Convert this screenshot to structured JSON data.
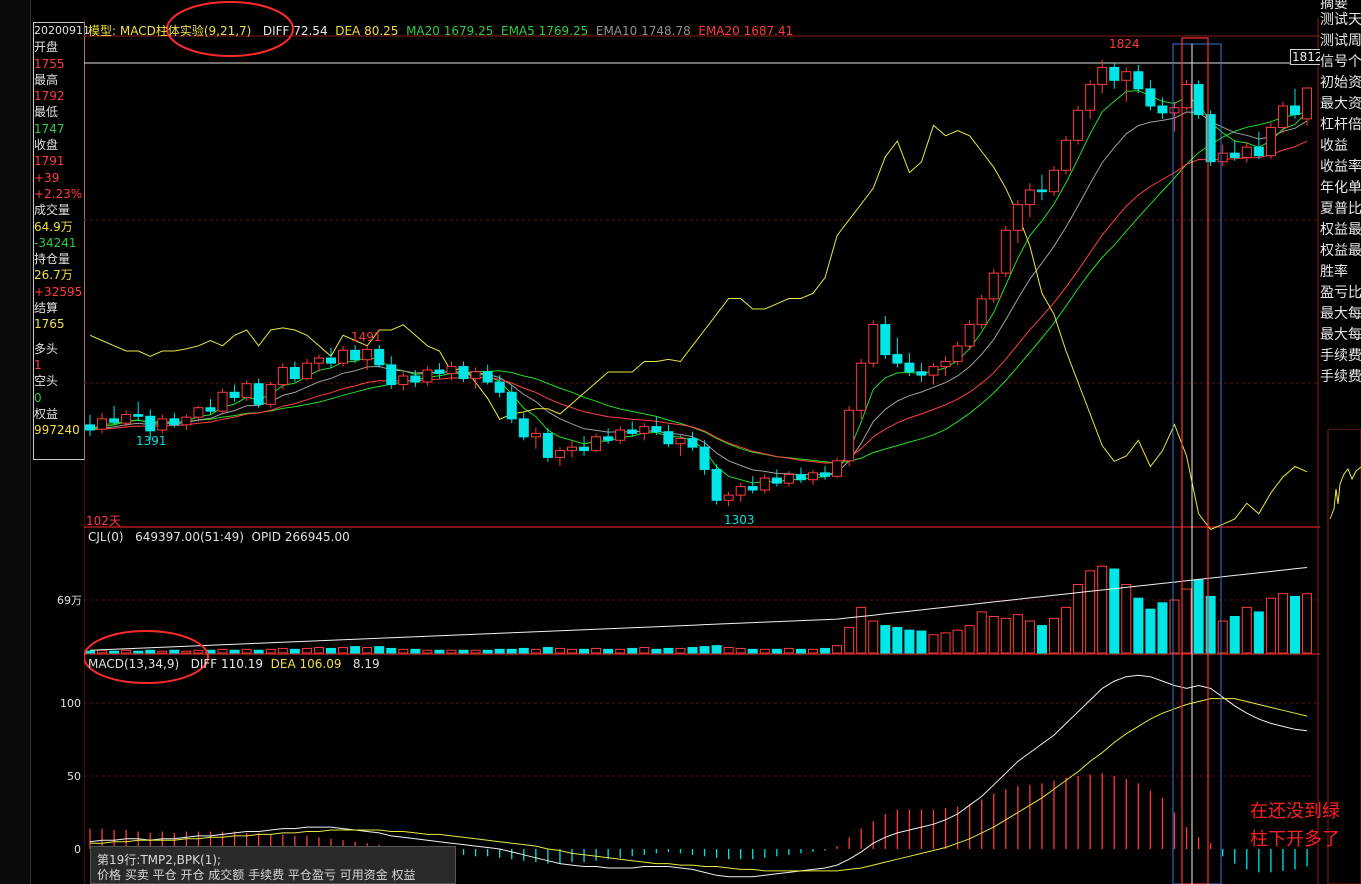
{
  "info": {
    "date": "20200911",
    "open_label": "开盘",
    "open": "1755",
    "high_label": "最高",
    "high": "1792",
    "low_label": "最低",
    "low": "1747",
    "close_label": "收盘",
    "close": "1791",
    "change": "+39",
    "change_pct": "+2.23%",
    "volume_label": "成交量",
    "volume": "64.9万",
    "volume_chg": "-34241",
    "oi_label": "持仓量",
    "oi": "26.7万",
    "oi_chg": "+32595",
    "settle_label": "结算",
    "settle": "1765",
    "long_label": "多头",
    "long": "1",
    "short_label": "空头",
    "short": "0",
    "equity_label": "权益",
    "equity": "997240"
  },
  "header": {
    "model": "模型: MACD柱体实验(9,21,7)",
    "diff": "DIFF 72.54",
    "dea": "DEA 80.25",
    "ma20": "MA20 1679.25",
    "ema5": "EMA5 1769.25",
    "ema10": "EMA10 1748.78",
    "ema20": "EMA20 1687.41"
  },
  "price_labels": {
    "peak": "1824",
    "high_left": "1491",
    "low_left": "1391",
    "low_mid": "1303",
    "right_axis": "1812",
    "days": "102天"
  },
  "volume_header": {
    "name": "CJL(0)",
    "values": "649397.00(51:49)",
    "opid": "OPID 266945.00",
    "axis": "69万"
  },
  "macd_header": {
    "name": "MACD(13,34,9)",
    "diff": "DIFF 110.19",
    "dea": "DEA 106.09",
    "macd": "8.19"
  },
  "macd_axis": [
    "100",
    "50",
    "0"
  ],
  "right_panel": [
    "摘要",
    "测试天",
    "测试周",
    "信号个",
    "初始资",
    "最大资",
    "杠杆倍",
    "收益",
    "收益率",
    "年化单",
    "夏普比",
    "权益最",
    "权益最",
    "胜率",
    "盈亏比",
    "最大每",
    "最大每",
    "手续费",
    "手续费"
  ],
  "status": {
    "line1": "第19行:TMP2,BPK(1);",
    "line2": "价格  买卖  平仓  开仓  成交额  手续费  平仓盈亏  可用资金  权益"
  },
  "annotation": [
    "在还没到绿",
    "柱下开多了"
  ],
  "colors": {
    "up": "#ff3b3b",
    "down": "#00e5e5",
    "ma_green": "#22dd22",
    "ema_grey": "#a0a0a0",
    "ema_red": "#ff4040",
    "yellow": "#e8e840",
    "white": "#f0f0f0"
  },
  "chart_data": {
    "type": "candlestick",
    "x": "bars 1-102",
    "price_ylim": [
      1280,
      1840
    ],
    "candles": [
      [
        1398,
        1410,
        1385,
        1392
      ],
      [
        1393,
        1412,
        1388,
        1405
      ],
      [
        1405,
        1420,
        1398,
        1401
      ],
      [
        1400,
        1415,
        1395,
        1410
      ],
      [
        1410,
        1425,
        1404,
        1408
      ],
      [
        1408,
        1416,
        1380,
        1391
      ],
      [
        1392,
        1410,
        1388,
        1405
      ],
      [
        1405,
        1412,
        1395,
        1398
      ],
      [
        1398,
        1410,
        1392,
        1407
      ],
      [
        1407,
        1420,
        1402,
        1418
      ],
      [
        1418,
        1428,
        1410,
        1414
      ],
      [
        1414,
        1440,
        1410,
        1436
      ],
      [
        1436,
        1445,
        1425,
        1430
      ],
      [
        1430,
        1450,
        1426,
        1446
      ],
      [
        1446,
        1452,
        1418,
        1422
      ],
      [
        1422,
        1448,
        1418,
        1445
      ],
      [
        1445,
        1470,
        1440,
        1465
      ],
      [
        1465,
        1472,
        1448,
        1452
      ],
      [
        1452,
        1475,
        1450,
        1470
      ],
      [
        1470,
        1480,
        1460,
        1476
      ],
      [
        1476,
        1488,
        1465,
        1470
      ],
      [
        1470,
        1490,
        1466,
        1485
      ],
      [
        1485,
        1491,
        1470,
        1474
      ],
      [
        1474,
        1490,
        1462,
        1486
      ],
      [
        1486,
        1491,
        1465,
        1468
      ],
      [
        1468,
        1478,
        1440,
        1445
      ],
      [
        1445,
        1460,
        1438,
        1455
      ],
      [
        1455,
        1462,
        1442,
        1448
      ],
      [
        1448,
        1466,
        1444,
        1462
      ],
      [
        1462,
        1470,
        1452,
        1458
      ],
      [
        1458,
        1472,
        1450,
        1466
      ],
      [
        1466,
        1472,
        1448,
        1452
      ],
      [
        1452,
        1465,
        1440,
        1460
      ],
      [
        1460,
        1468,
        1445,
        1448
      ],
      [
        1448,
        1456,
        1430,
        1436
      ],
      [
        1436,
        1445,
        1400,
        1405
      ],
      [
        1405,
        1412,
        1380,
        1384
      ],
      [
        1384,
        1395,
        1370,
        1388
      ],
      [
        1388,
        1394,
        1355,
        1360
      ],
      [
        1360,
        1372,
        1350,
        1368
      ],
      [
        1368,
        1380,
        1360,
        1372
      ],
      [
        1372,
        1385,
        1362,
        1368
      ],
      [
        1368,
        1388,
        1366,
        1384
      ],
      [
        1384,
        1394,
        1376,
        1380
      ],
      [
        1380,
        1396,
        1376,
        1392
      ],
      [
        1392,
        1402,
        1384,
        1388
      ],
      [
        1388,
        1400,
        1380,
        1396
      ],
      [
        1396,
        1408,
        1386,
        1390
      ],
      [
        1390,
        1398,
        1372,
        1376
      ],
      [
        1376,
        1386,
        1362,
        1382
      ],
      [
        1382,
        1390,
        1368,
        1372
      ],
      [
        1372,
        1380,
        1340,
        1346
      ],
      [
        1346,
        1352,
        1305,
        1310
      ],
      [
        1310,
        1320,
        1303,
        1316
      ],
      [
        1316,
        1330,
        1308,
        1326
      ],
      [
        1326,
        1338,
        1318,
        1322
      ],
      [
        1322,
        1340,
        1318,
        1336
      ],
      [
        1336,
        1346,
        1326,
        1330
      ],
      [
        1330,
        1344,
        1326,
        1340
      ],
      [
        1340,
        1348,
        1330,
        1334
      ],
      [
        1334,
        1345,
        1328,
        1342
      ],
      [
        1342,
        1350,
        1334,
        1338
      ],
      [
        1338,
        1360,
        1336,
        1356
      ],
      [
        1356,
        1420,
        1350,
        1415
      ],
      [
        1415,
        1475,
        1405,
        1470
      ],
      [
        1470,
        1520,
        1465,
        1515
      ],
      [
        1515,
        1525,
        1475,
        1480
      ],
      [
        1480,
        1500,
        1465,
        1470
      ],
      [
        1470,
        1482,
        1455,
        1460
      ],
      [
        1460,
        1470,
        1448,
        1456
      ],
      [
        1456,
        1470,
        1445,
        1466
      ],
      [
        1466,
        1478,
        1455,
        1472
      ],
      [
        1472,
        1495,
        1468,
        1490
      ],
      [
        1490,
        1520,
        1485,
        1515
      ],
      [
        1515,
        1550,
        1510,
        1545
      ],
      [
        1545,
        1580,
        1540,
        1575
      ],
      [
        1575,
        1630,
        1570,
        1625
      ],
      [
        1625,
        1660,
        1610,
        1655
      ],
      [
        1655,
        1680,
        1640,
        1672
      ],
      [
        1672,
        1690,
        1660,
        1670
      ],
      [
        1670,
        1700,
        1665,
        1695
      ],
      [
        1695,
        1735,
        1690,
        1730
      ],
      [
        1730,
        1770,
        1725,
        1765
      ],
      [
        1765,
        1800,
        1755,
        1795
      ],
      [
        1795,
        1824,
        1785,
        1815
      ],
      [
        1815,
        1820,
        1790,
        1800
      ],
      [
        1800,
        1815,
        1775,
        1810
      ],
      [
        1810,
        1818,
        1785,
        1790
      ],
      [
        1790,
        1800,
        1765,
        1770
      ],
      [
        1770,
        1780,
        1755,
        1762
      ],
      [
        1762,
        1775,
        1740,
        1768
      ],
      [
        1768,
        1800,
        1765,
        1795
      ],
      [
        1795,
        1800,
        1755,
        1760
      ],
      [
        1760,
        1765,
        1700,
        1705
      ],
      [
        1705,
        1725,
        1700,
        1715
      ],
      [
        1715,
        1730,
        1706,
        1710
      ],
      [
        1710,
        1728,
        1704,
        1722
      ],
      [
        1722,
        1740,
        1708,
        1712
      ],
      [
        1712,
        1750,
        1708,
        1745
      ],
      [
        1745,
        1775,
        1738,
        1770
      ],
      [
        1770,
        1790,
        1755,
        1760
      ],
      [
        1755,
        1792,
        1747,
        1791
      ]
    ],
    "volume_ylim": [
      0,
      1200000
    ],
    "volume_wan": [
      2,
      3,
      2,
      3,
      2,
      3,
      2,
      3,
      2,
      3,
      3,
      4,
      3,
      4,
      3,
      4,
      5,
      4,
      5,
      6,
      5,
      6,
      7,
      6,
      7,
      5,
      4,
      4,
      3,
      3,
      3,
      3,
      3,
      3,
      4,
      4,
      5,
      4,
      6,
      5,
      4,
      4,
      5,
      4,
      4,
      5,
      6,
      4,
      5,
      5,
      6,
      7,
      8,
      6,
      5,
      4,
      4,
      4,
      5,
      4,
      4,
      5,
      8,
      28,
      50,
      35,
      30,
      28,
      25,
      24,
      20,
      22,
      25,
      30,
      45,
      40,
      38,
      42,
      35,
      30,
      38,
      50,
      75,
      90,
      95,
      92,
      75,
      60,
      48,
      55,
      58,
      70,
      80,
      62,
      35,
      40,
      50,
      45,
      60,
      65,
      62,
      64.9
    ],
    "macd_ylim": [
      -20,
      125
    ],
    "macd_diff": [
      5,
      6,
      6,
      7,
      7,
      6,
      7,
      7,
      8,
      9,
      9,
      10,
      11,
      12,
      12,
      13,
      14,
      14,
      15,
      15,
      15,
      14,
      13,
      12,
      11,
      9,
      8,
      7,
      6,
      5,
      4,
      3,
      2,
      1,
      0,
      -2,
      -4,
      -6,
      -8,
      -10,
      -11,
      -12,
      -12,
      -13,
      -13,
      -13,
      -12,
      -12,
      -12,
      -13,
      -14,
      -16,
      -18,
      -19,
      -19,
      -19,
      -18,
      -17,
      -16,
      -15,
      -14,
      -13,
      -11,
      -7,
      -2,
      4,
      8,
      11,
      13,
      15,
      17,
      20,
      24,
      30,
      36,
      44,
      52,
      60,
      66,
      72,
      78,
      86,
      94,
      102,
      110,
      115,
      118,
      119,
      118,
      115,
      112,
      110,
      112,
      110,
      104,
      98,
      93,
      89,
      86,
      84,
      82,
      81
    ],
    "macd_dea": [
      4,
      4,
      5,
      5,
      6,
      6,
      6,
      6,
      7,
      7,
      8,
      8,
      9,
      9,
      10,
      10,
      11,
      11,
      12,
      12,
      13,
      13,
      13,
      13,
      13,
      12,
      12,
      11,
      10,
      10,
      9,
      8,
      7,
      6,
      5,
      4,
      3,
      2,
      0,
      -1,
      -3,
      -4,
      -5,
      -6,
      -7,
      -8,
      -9,
      -10,
      -10,
      -11,
      -11,
      -12,
      -12,
      -13,
      -14,
      -14,
      -15,
      -15,
      -15,
      -15,
      -15,
      -15,
      -15,
      -14,
      -13,
      -11,
      -9,
      -7,
      -5,
      -3,
      -1,
      1,
      4,
      7,
      11,
      15,
      20,
      25,
      30,
      35,
      41,
      47,
      53,
      60,
      66,
      73,
      79,
      84,
      89,
      93,
      96,
      99,
      101,
      103,
      103,
      103,
      101,
      99,
      97,
      95,
      93,
      91
    ],
    "macd_hist": [
      14,
      14,
      13,
      13,
      12,
      11,
      12,
      11,
      12,
      12,
      12,
      12,
      12,
      11,
      11,
      10,
      10,
      9,
      9,
      8,
      7,
      6,
      5,
      4,
      3,
      2,
      1,
      0,
      -1,
      -2,
      -3,
      -4,
      -5,
      -5,
      -6,
      -7,
      -8,
      -9,
      -10,
      -10,
      -9,
      -9,
      -8,
      -7,
      -6,
      -5,
      -4,
      -3,
      -2,
      -3,
      -4,
      -5,
      -6,
      -7,
      -7,
      -7,
      -6,
      -5,
      -4,
      -3,
      -2,
      -1,
      2,
      8,
      14,
      19,
      24,
      27,
      27,
      27,
      27,
      28,
      29,
      31,
      34,
      38,
      41,
      43,
      44,
      45,
      47,
      49,
      50,
      51,
      52,
      50,
      48,
      45,
      40,
      35,
      25,
      15,
      8,
      4,
      -5,
      -10,
      -14,
      -16,
      -16,
      -15,
      -14,
      -12
    ],
    "equity_yellow": [
      1055,
      1050,
      1045,
      1040,
      1040,
      1035,
      1040,
      1040,
      1042,
      1045,
      1050,
      1045,
      1055,
      1060,
      1045,
      1060,
      1062,
      1060,
      1055,
      1045,
      1035,
      1055,
      1050,
      1045,
      1060,
      1060,
      1065,
      1055,
      1045,
      1040,
      1020,
      1025,
      1010,
      995,
      975,
      980,
      982,
      985,
      985,
      980,
      990,
      1000,
      1010,
      1020,
      1020,
      1020,
      1030,
      1030,
      1032,
      1030,
      1045,
      1060,
      1075,
      1090,
      1090,
      1080,
      1080,
      1085,
      1090,
      1090,
      1095,
      1110,
      1150,
      1165,
      1180,
      1195,
      1225,
      1240,
      1210,
      1220,
      1255,
      1245,
      1250,
      1245,
      1230,
      1215,
      1195,
      1170,
      1140,
      1095,
      1075,
      1040,
      1010,
      980,
      950,
      935,
      940,
      955,
      930,
      945,
      970,
      940,
      885,
      870,
      875,
      880,
      895,
      885,
      905,
      920,
      930,
      925
    ]
  }
}
